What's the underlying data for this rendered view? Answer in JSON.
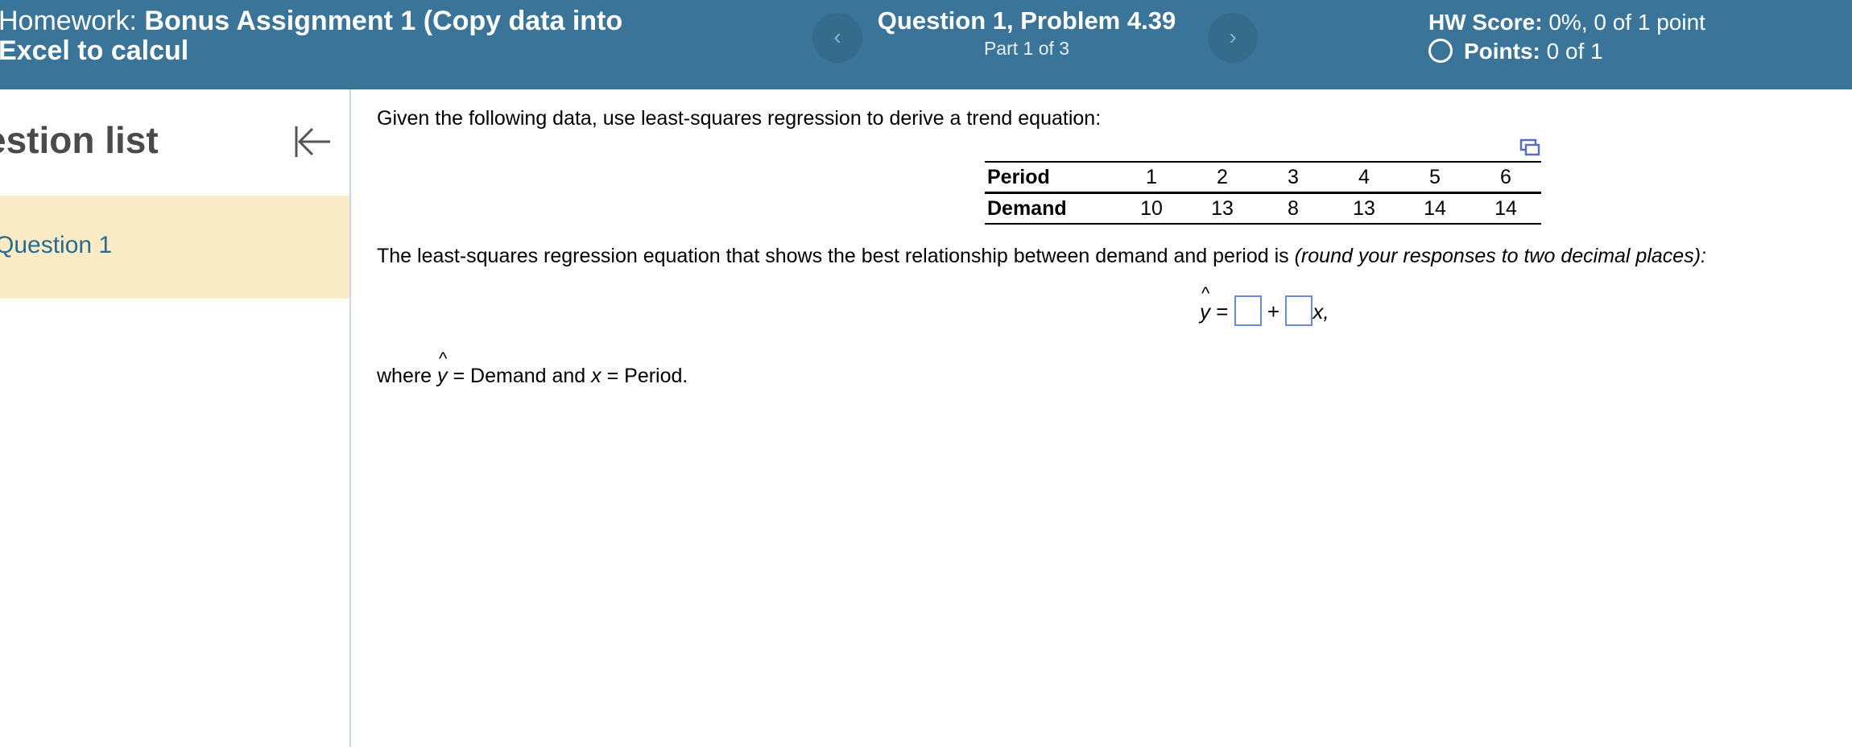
{
  "header": {
    "homework_label": "Homework:",
    "homework_name_line1": "Bonus Assignment 1 (Copy data into",
    "homework_name_line2": "Excel to calcul",
    "prev_icon": "chevron-left-icon",
    "next_icon": "chevron-right-icon",
    "prev_glyph": "‹",
    "next_glyph": "›",
    "question_title": "Question 1, Problem 4.39",
    "part": "Part 1 of 3",
    "hw_score_label": "HW Score:",
    "hw_score_value": "0%, 0 of 1 point",
    "points_label": "Points:",
    "points_value": "0 of 1",
    "colors": {
      "bar": "#3a7599",
      "text": "#ffffff"
    }
  },
  "sidebar": {
    "title": "estion list",
    "collapse_icon": "collapse-left-icon",
    "items": [
      {
        "label": "Question 1",
        "selected": true
      }
    ],
    "colors": {
      "selected_bg": "#f8ebc6",
      "item_text": "#2a6a8e"
    }
  },
  "question": {
    "prompt": "Given the following data, use least-squares regression to derive a trend equation:",
    "expand_icon": "expand-icon",
    "table": {
      "rows": [
        {
          "header": "Period",
          "values": [
            "1",
            "2",
            "3",
            "4",
            "5",
            "6"
          ]
        },
        {
          "header": "Demand",
          "values": [
            "10",
            "13",
            "8",
            "13",
            "14",
            "14"
          ]
        }
      ]
    },
    "statement": "The least-squares regression equation that shows the best relationship between demand and period is",
    "statement_note": "(round your responses to two decimal places):",
    "equation": {
      "y": "y",
      "equals": "=",
      "plus": "+",
      "x_suffix": "x,",
      "answer1": "",
      "answer2": ""
    },
    "where": {
      "prefix": "where",
      "y": "y",
      "mid": "= Demand and",
      "x": "x",
      "suffix": "= Period."
    }
  }
}
